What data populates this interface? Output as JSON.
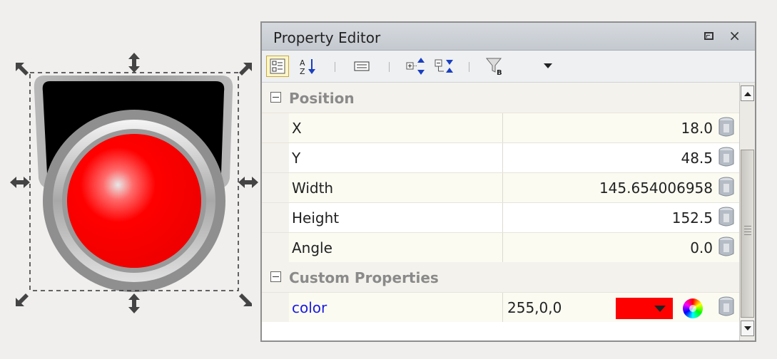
{
  "panel": {
    "title": "Property Editor",
    "close_label": "×"
  },
  "sections": {
    "position": {
      "label": "Position"
    },
    "custom": {
      "label": "Custom Properties"
    }
  },
  "properties": {
    "x": {
      "name": "X",
      "value": "18.0"
    },
    "y": {
      "name": "Y",
      "value": "48.5"
    },
    "width": {
      "name": "Width",
      "value": "145.654006958"
    },
    "height": {
      "name": "Height",
      "value": "152.5"
    },
    "angle": {
      "name": "Angle",
      "value": "0.0"
    }
  },
  "custom_properties": {
    "color": {
      "name": "color",
      "value": "255,0,0",
      "swatch": "#ff0000"
    }
  },
  "icons": {
    "toolbar": [
      "categorized-view-icon",
      "sort-alphabetical-icon",
      "description-icon",
      "expand-all-icon",
      "collapse-all-icon",
      "filter-icon",
      "dropdown-arrow-icon"
    ],
    "row": "binding-icon"
  },
  "colors": {
    "button_red": "#ff0000",
    "custom_property_text": "#1a1adf",
    "section_text": "#8a8a8a"
  }
}
